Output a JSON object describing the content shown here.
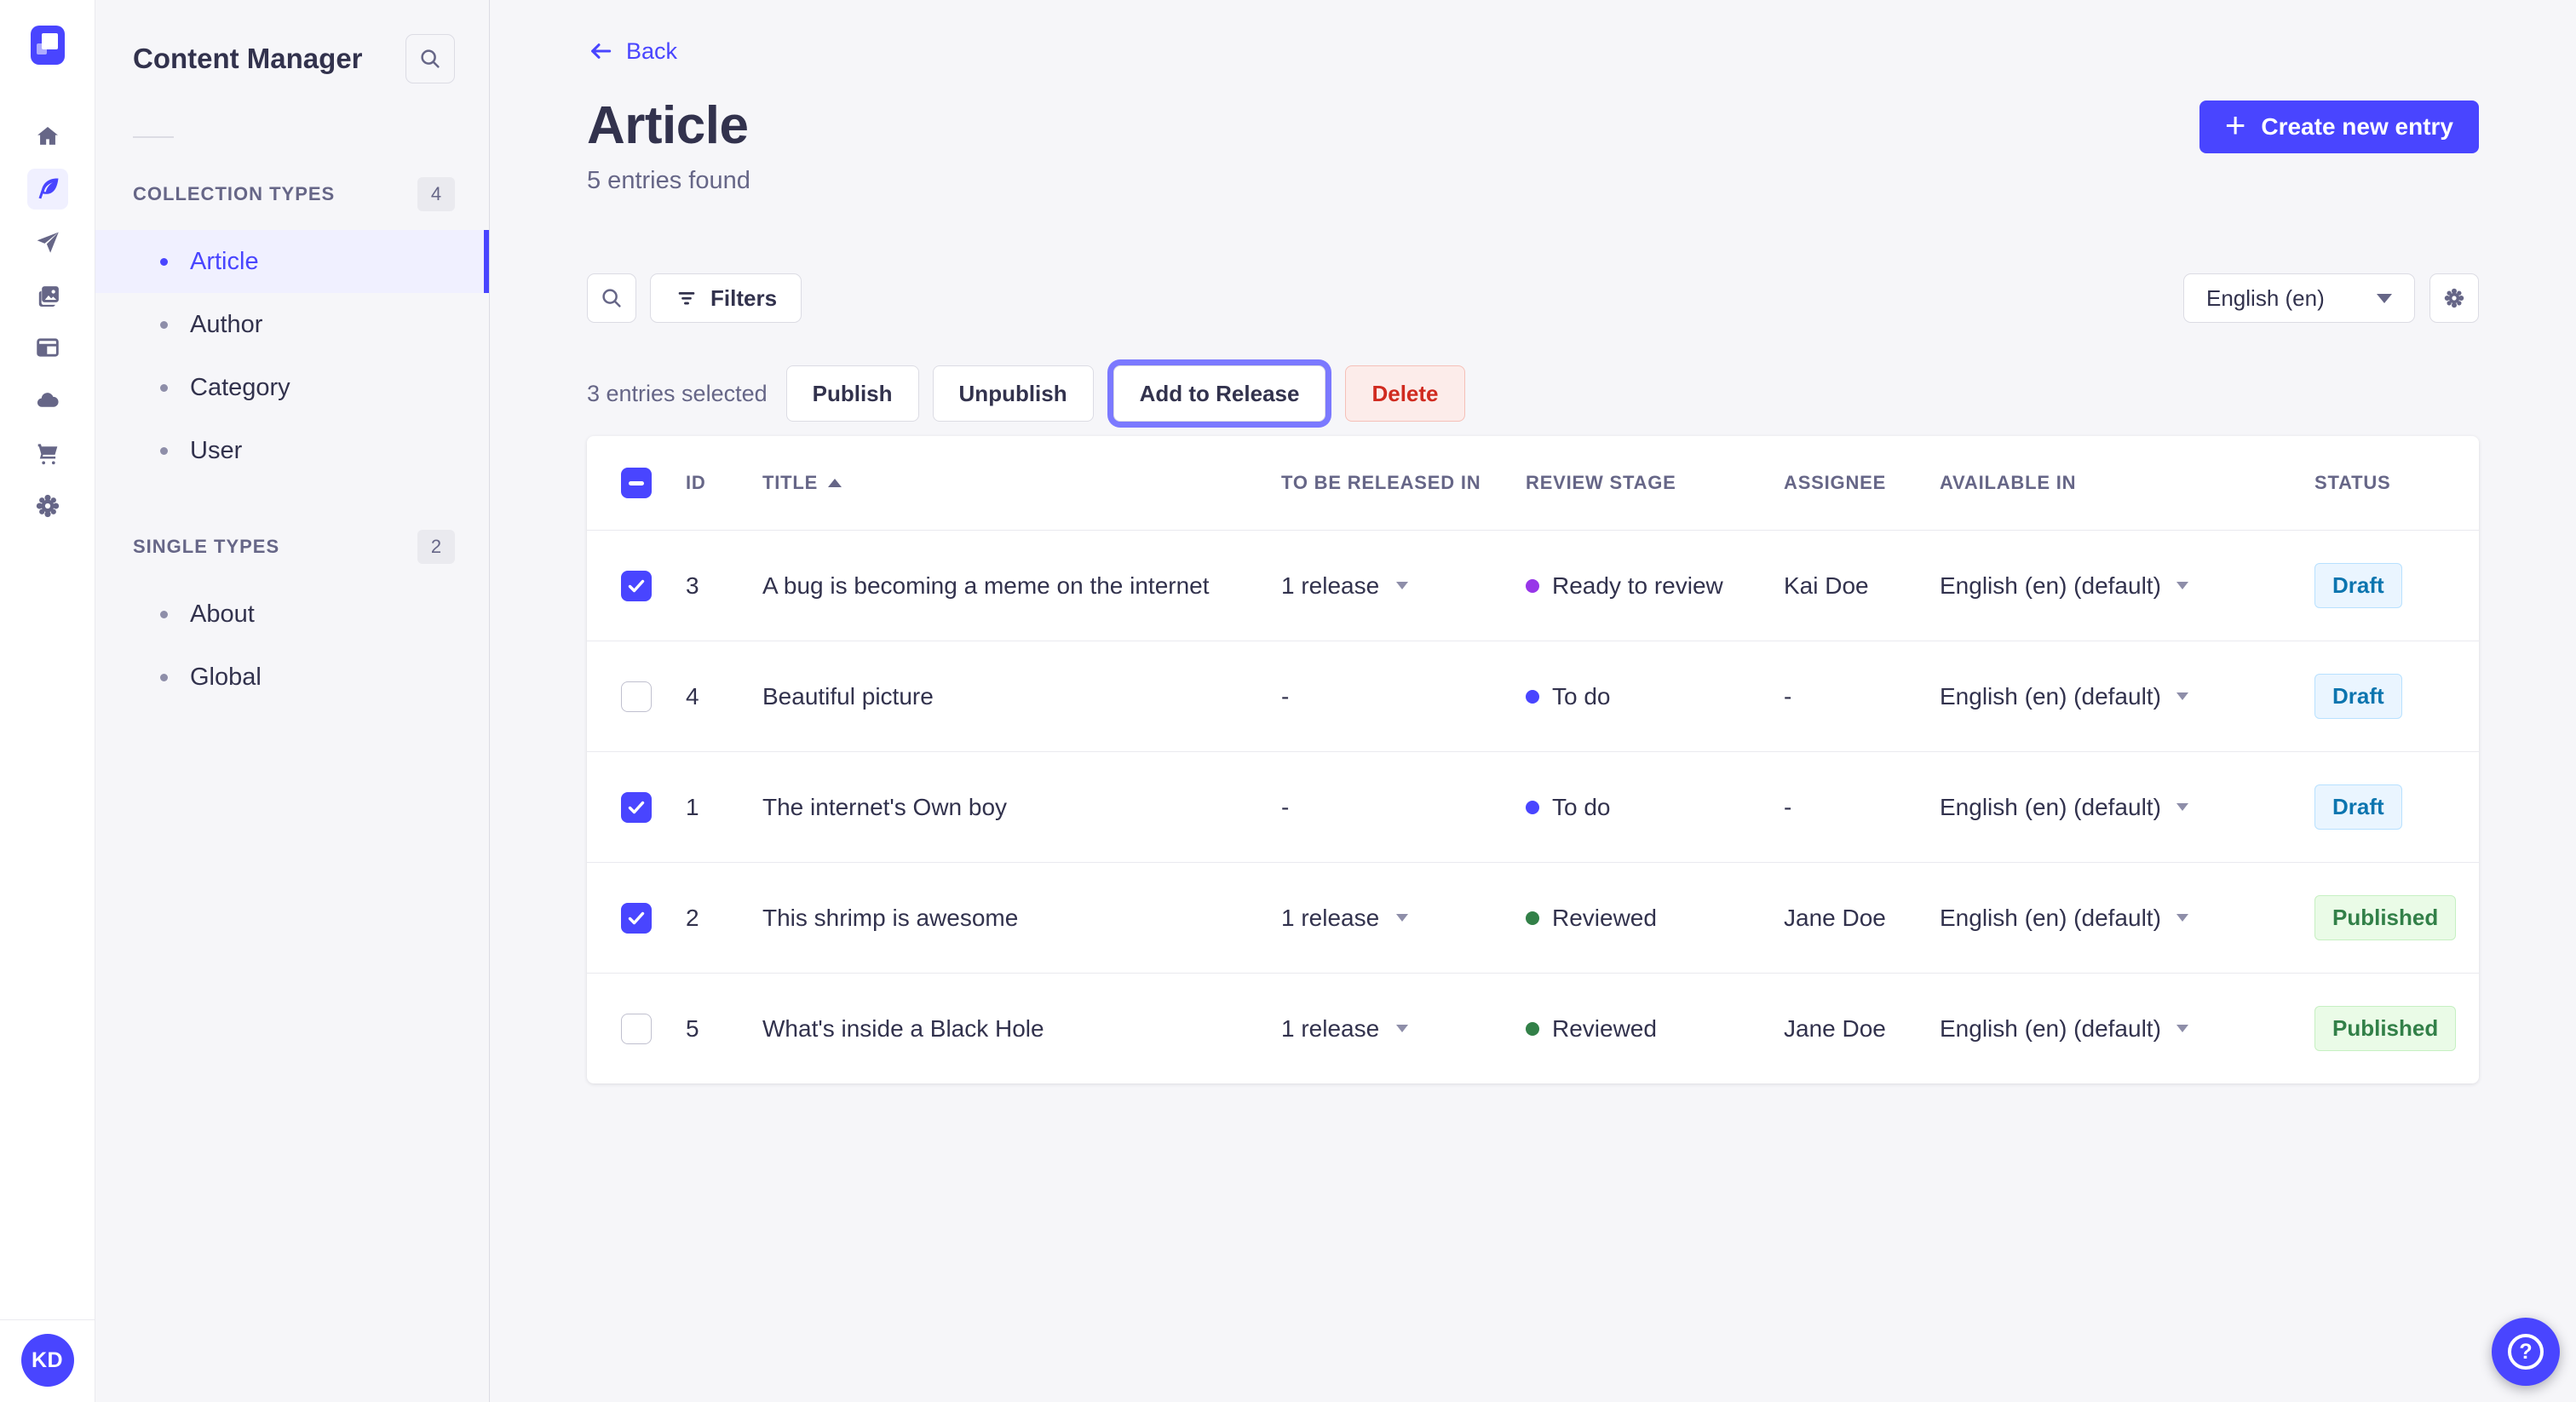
{
  "app": {
    "primary_color": "#4945FF"
  },
  "icon_sidebar": {
    "items": [
      {
        "icon": "home-icon",
        "active": false
      },
      {
        "icon": "content-manager-feather-icon",
        "active": true
      },
      {
        "icon": "release-paper-plane-icon",
        "active": false
      },
      {
        "icon": "media-library-icon",
        "active": false
      },
      {
        "icon": "content-type-builder-icon",
        "active": false
      },
      {
        "icon": "deploy-cloud-icon",
        "active": false
      },
      {
        "icon": "marketplace-cart-icon",
        "active": false
      },
      {
        "icon": "settings-gear-icon",
        "active": false
      }
    ],
    "avatar_initials": "KD"
  },
  "content_sidebar": {
    "title": "Content Manager",
    "sections": [
      {
        "label": "COLLECTION TYPES",
        "count": "4",
        "items": [
          {
            "label": "Article",
            "active": true
          },
          {
            "label": "Author",
            "active": false
          },
          {
            "label": "Category",
            "active": false
          },
          {
            "label": "User",
            "active": false
          }
        ]
      },
      {
        "label": "SINGLE TYPES",
        "count": "2",
        "items": [
          {
            "label": "About",
            "active": false
          },
          {
            "label": "Global",
            "active": false
          }
        ]
      }
    ]
  },
  "header": {
    "back_label": "Back",
    "title": "Article",
    "subtitle": "5 entries found",
    "create_button_label": "Create new entry"
  },
  "toolbar": {
    "filters_label": "Filters",
    "locale_value": "English (en)"
  },
  "selection_bar": {
    "selected_text": "3 entries selected",
    "publish_label": "Publish",
    "unpublish_label": "Unpublish",
    "add_to_release_label": "Add to Release",
    "delete_label": "Delete"
  },
  "table": {
    "select_all_state": "indeterminate",
    "sort_column": "TITLE",
    "sort_direction": "asc",
    "columns": [
      "ID",
      "TITLE",
      "TO BE RELEASED IN",
      "REVIEW STAGE",
      "ASSIGNEE",
      "AVAILABLE IN",
      "STATUS"
    ],
    "rows": [
      {
        "checked": true,
        "id": "3",
        "title": "A bug is becoming a meme on the internet",
        "release": "1 release",
        "stage": "Ready to review",
        "stage_color": "#9736E8",
        "assignee": "Kai Doe",
        "locale": "English (en) (default)",
        "status": "Draft",
        "status_type": "draft"
      },
      {
        "checked": false,
        "id": "4",
        "title": "Beautiful picture",
        "release": "-",
        "stage": "To do",
        "stage_color": "#4945FF",
        "assignee": "-",
        "locale": "English (en) (default)",
        "status": "Draft",
        "status_type": "draft"
      },
      {
        "checked": true,
        "id": "1",
        "title": "The internet's Own boy",
        "release": "-",
        "stage": "To do",
        "stage_color": "#4945FF",
        "assignee": "-",
        "locale": "English (en) (default)",
        "status": "Draft",
        "status_type": "draft"
      },
      {
        "checked": true,
        "id": "2",
        "title": "This shrimp is awesome",
        "release": "1 release",
        "stage": "Reviewed",
        "stage_color": "#328048",
        "assignee": "Jane Doe",
        "locale": "English (en) (default)",
        "status": "Published",
        "status_type": "published"
      },
      {
        "checked": false,
        "id": "5",
        "title": "What's inside a Black Hole",
        "release": "1 release",
        "stage": "Reviewed",
        "stage_color": "#328048",
        "assignee": "Jane Doe",
        "locale": "English (en) (default)",
        "status": "Published",
        "status_type": "published"
      }
    ]
  },
  "status_colors": {
    "draft_bg": "#EAF5FF",
    "draft_text": "#0C75AF",
    "published_bg": "#EAFBE7",
    "published_text": "#328048"
  }
}
